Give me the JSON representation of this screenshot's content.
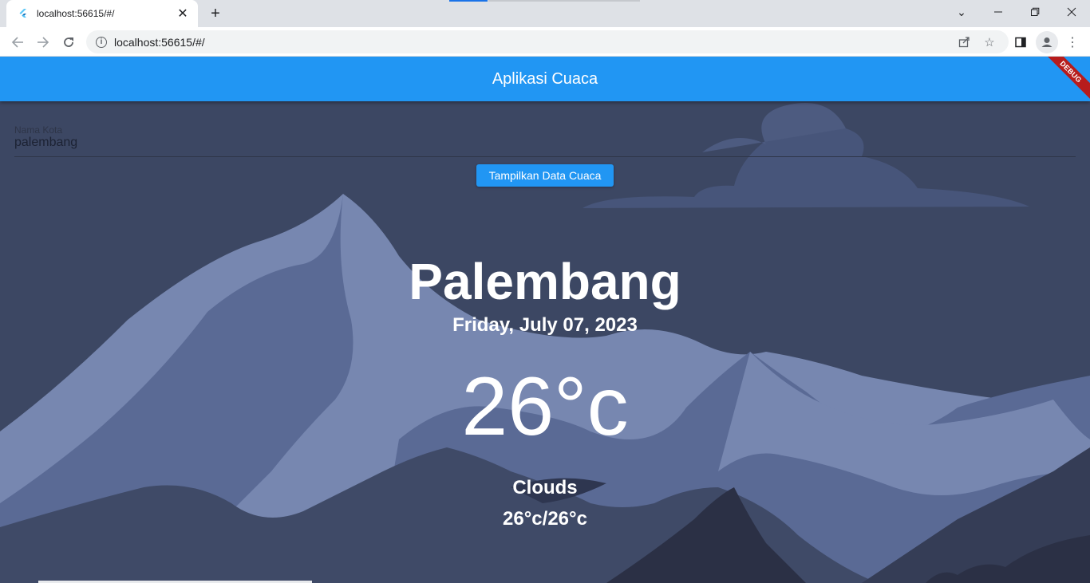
{
  "browser": {
    "tab_title": "localhost:56615/#/",
    "url": "localhost:56615/#/",
    "icons": [
      "flutter-icon",
      "close-icon",
      "plus-icon",
      "chevron-down-icon",
      "minimize-icon",
      "restore-icon",
      "window-close-icon",
      "back-icon",
      "forward-icon",
      "reload-icon",
      "info-icon",
      "share-icon",
      "star-icon",
      "side-panel-icon",
      "profile-icon",
      "menu-icon"
    ]
  },
  "app": {
    "title": "Aplikasi Cuaca",
    "debug_banner": "DEBUG",
    "city_field": {
      "label": "Nama Kota",
      "value": "palembang"
    },
    "button_label": "Tampilkan Data Cuaca",
    "weather": {
      "city": "Palembang",
      "date": "Friday, July 07, 2023",
      "temperature": "26°c",
      "condition": "Clouds",
      "min_max": "26°c/26°c"
    }
  },
  "colors": {
    "appbar": "#2196f3",
    "button": "#2196f3",
    "sky": "#3c4763",
    "mountain_light": "#7787b0",
    "mountain_mid": "#5a6a95",
    "mountain_dark": "#2b3045"
  }
}
